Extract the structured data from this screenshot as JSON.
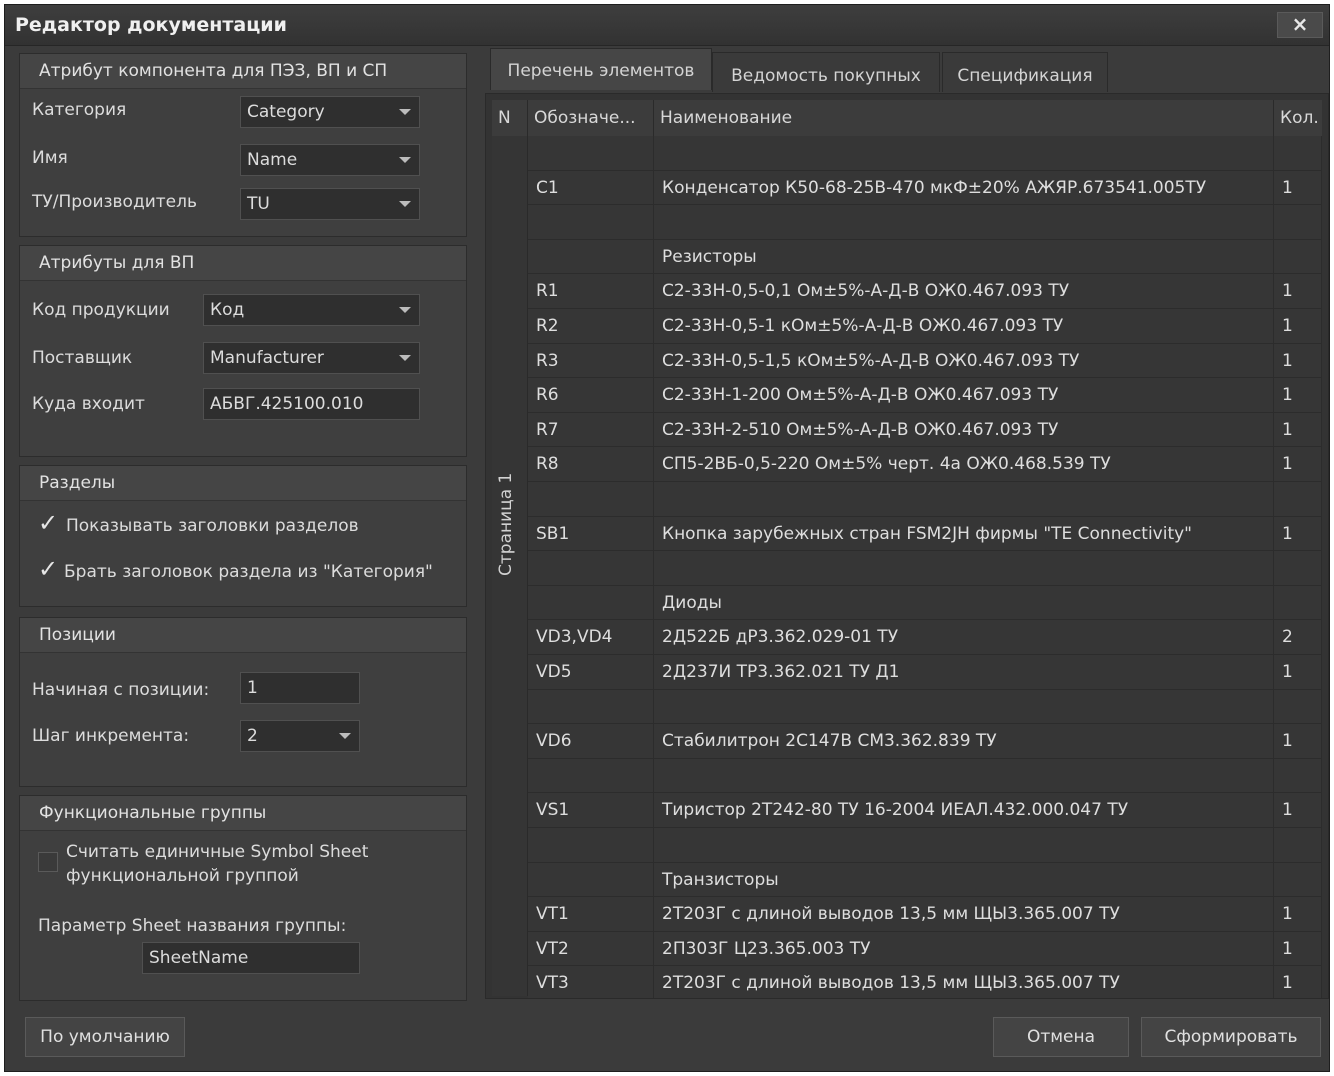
{
  "window": {
    "title": "Редактор документации",
    "close_label": "×"
  },
  "component_attrs": {
    "header": "Атрибут компонента для ПЭЗ, ВП и СП",
    "category_label": "Категория",
    "category_value": "Category",
    "name_label": "Имя",
    "name_value": "Name",
    "tu_label": "ТУ/Производитель",
    "tu_value": "TU"
  },
  "vp_attrs": {
    "header": "Атрибуты для ВП",
    "code_label": "Код продукции",
    "code_value": "Код",
    "supplier_label": "Поставщик",
    "supplier_value": "Manufacturer",
    "entry_label": "Куда входит",
    "entry_value": "АБВГ.425100.010"
  },
  "sections": {
    "header": "Разделы",
    "show_headers_label": "Показывать заголовки разделов",
    "show_headers_checked": true,
    "take_from_category_label": "Брать заголовок раздела из \"Категория\"",
    "take_from_category_checked": true
  },
  "positions": {
    "header": "Позиции",
    "start_label": "Начиная с позиции:",
    "start_value": "1",
    "step_label": "Шаг инкремента:",
    "step_value": "2"
  },
  "func_groups": {
    "header": "Функциональные группы",
    "single_sheet_label_1": "Считать единичные Symbol Sheet",
    "single_sheet_label_2": "функциональной группой",
    "single_sheet_checked": false,
    "param_label": "Параметр Sheet названия группы:",
    "param_value": "SheetName"
  },
  "tabs": [
    "Перечень элементов",
    "Ведомость покупных",
    "Спецификация"
  ],
  "table": {
    "columns": [
      "N",
      "Обозначе...",
      "Наименование",
      "Кол."
    ],
    "page_label": "Страница 1",
    "rows": [
      {
        "ref": "",
        "name": "",
        "qty": ""
      },
      {
        "ref": "C1",
        "name": "Конденсатор К50-68-25В-470 мкФ±20% АЖЯР.673541.005ТУ",
        "qty": "1"
      },
      {
        "ref": "",
        "name": "",
        "qty": ""
      },
      {
        "ref": "",
        "name": "Резисторы",
        "qty": ""
      },
      {
        "ref": "R1",
        "name": "С2-33Н-0,5-0,1 Ом±5%-А-Д-В ОЖ0.467.093 ТУ",
        "qty": "1"
      },
      {
        "ref": "R2",
        "name": "С2-33Н-0,5-1 кОм±5%-А-Д-В ОЖ0.467.093 ТУ",
        "qty": "1"
      },
      {
        "ref": "R3",
        "name": "С2-33Н-0,5-1,5 кОм±5%-А-Д-В ОЖ0.467.093 ТУ",
        "qty": "1"
      },
      {
        "ref": "R6",
        "name": "С2-33Н-1-200 Ом±5%-А-Д-В ОЖ0.467.093 ТУ",
        "qty": "1"
      },
      {
        "ref": "R7",
        "name": "С2-33Н-2-510 Ом±5%-А-Д-В ОЖ0.467.093 ТУ",
        "qty": "1"
      },
      {
        "ref": "R8",
        "name": "СП5-2ВБ-0,5-220 Ом±5% черт. 4а ОЖ0.468.539 ТУ",
        "qty": "1"
      },
      {
        "ref": "",
        "name": "",
        "qty": ""
      },
      {
        "ref": "SB1",
        "name": "Кнопка зарубежных стран FSM2JH фирмы \"TE Connectivity\"",
        "qty": "1"
      },
      {
        "ref": "",
        "name": "",
        "qty": ""
      },
      {
        "ref": "",
        "name": "Диоды",
        "qty": ""
      },
      {
        "ref": "VD3,VD4",
        "name": "2Д522Б дР3.362.029-01 ТУ",
        "qty": "2"
      },
      {
        "ref": "VD5",
        "name": "2Д237И ТР3.362.021 ТУ Д1",
        "qty": "1"
      },
      {
        "ref": "",
        "name": "",
        "qty": ""
      },
      {
        "ref": "VD6",
        "name": "Стабилитрон 2С147В СМ3.362.839 ТУ",
        "qty": "1"
      },
      {
        "ref": "",
        "name": "",
        "qty": ""
      },
      {
        "ref": "VS1",
        "name": "Тиристор 2Т242-80 ТУ 16-2004 ИЕАЛ.432.000.047 ТУ",
        "qty": "1"
      },
      {
        "ref": "",
        "name": "",
        "qty": ""
      },
      {
        "ref": "",
        "name": "Транзисторы",
        "qty": ""
      },
      {
        "ref": "VT1",
        "name": "2Т203Г с длиной выводов 13,5 мм ЩЫ3.365.007 ТУ",
        "qty": "1"
      },
      {
        "ref": "VT2",
        "name": "2П303Г Ц23.365.003 ТУ",
        "qty": "1"
      },
      {
        "ref": "VT3",
        "name": "2Т203Г с длиной выводов 13,5 мм ЩЫ3.365.007 ТУ",
        "qty": "1"
      }
    ]
  },
  "footer": {
    "defaults_label": "По умолчанию",
    "cancel_label": "Отмена",
    "generate_label": "Сформировать"
  },
  "icons": {
    "check": "checkmark-icon",
    "dropdown": "chevron-down-icon"
  }
}
